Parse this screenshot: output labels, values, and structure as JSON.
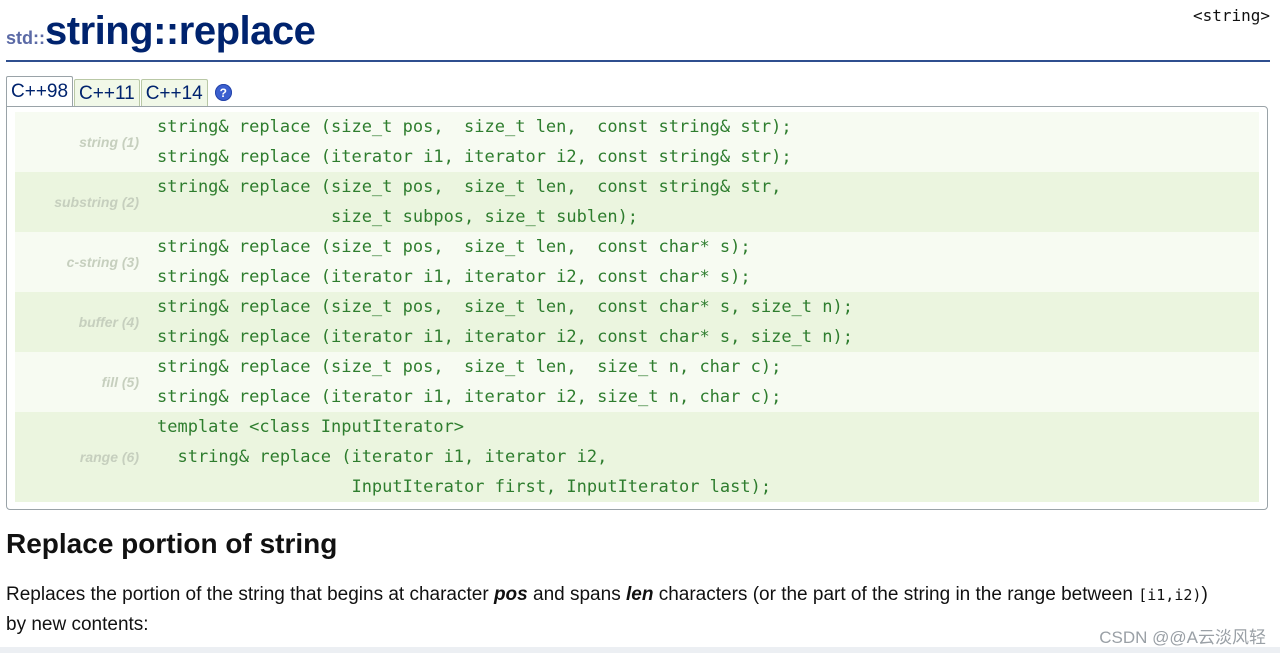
{
  "page": {
    "title_ns": "std::",
    "title_main": "string::replace",
    "header_file": "<string>"
  },
  "tabs": [
    {
      "label": "C++98",
      "active": true
    },
    {
      "label": "C++11",
      "active": false
    },
    {
      "label": "C++14",
      "active": false
    }
  ],
  "help_icon": "question-circle-icon",
  "prototypes": [
    {
      "label": "string (1)",
      "lines": [
        "string& replace (size_t pos,  size_t len,  const string& str);",
        "string& replace (iterator i1, iterator i2, const string& str);"
      ]
    },
    {
      "label": "substring (2)",
      "lines": [
        "string& replace (size_t pos,  size_t len,  const string& str,",
        "                 size_t subpos, size_t sublen);"
      ]
    },
    {
      "label": "c-string (3)",
      "lines": [
        "string& replace (size_t pos,  size_t len,  const char* s);",
        "string& replace (iterator i1, iterator i2, const char* s);"
      ]
    },
    {
      "label": "buffer (4)",
      "lines": [
        "string& replace (size_t pos,  size_t len,  const char* s, size_t n);",
        "string& replace (iterator i1, iterator i2, const char* s, size_t n);"
      ]
    },
    {
      "label": "fill (5)",
      "lines": [
        "string& replace (size_t pos,  size_t len,  size_t n, char c);",
        "string& replace (iterator i1, iterator i2, size_t n, char c);"
      ]
    },
    {
      "label": "range (6)",
      "lines": [
        "template <class InputIterator>",
        "  string& replace (iterator i1, iterator i2,",
        "                   InputIterator first, InputIterator last);"
      ]
    }
  ],
  "section": {
    "heading": "Replace portion of string",
    "desc_1": "Replaces the portion of the string that begins at character ",
    "desc_pos": "pos",
    "desc_2": " and spans ",
    "desc_len": "len",
    "desc_3": " characters (or the part of the string in the range between ",
    "desc_range": "[i1,i2)",
    "desc_4": ")",
    "desc_5": "by new contents:"
  },
  "watermark": "CSDN @@A云淡风轻"
}
